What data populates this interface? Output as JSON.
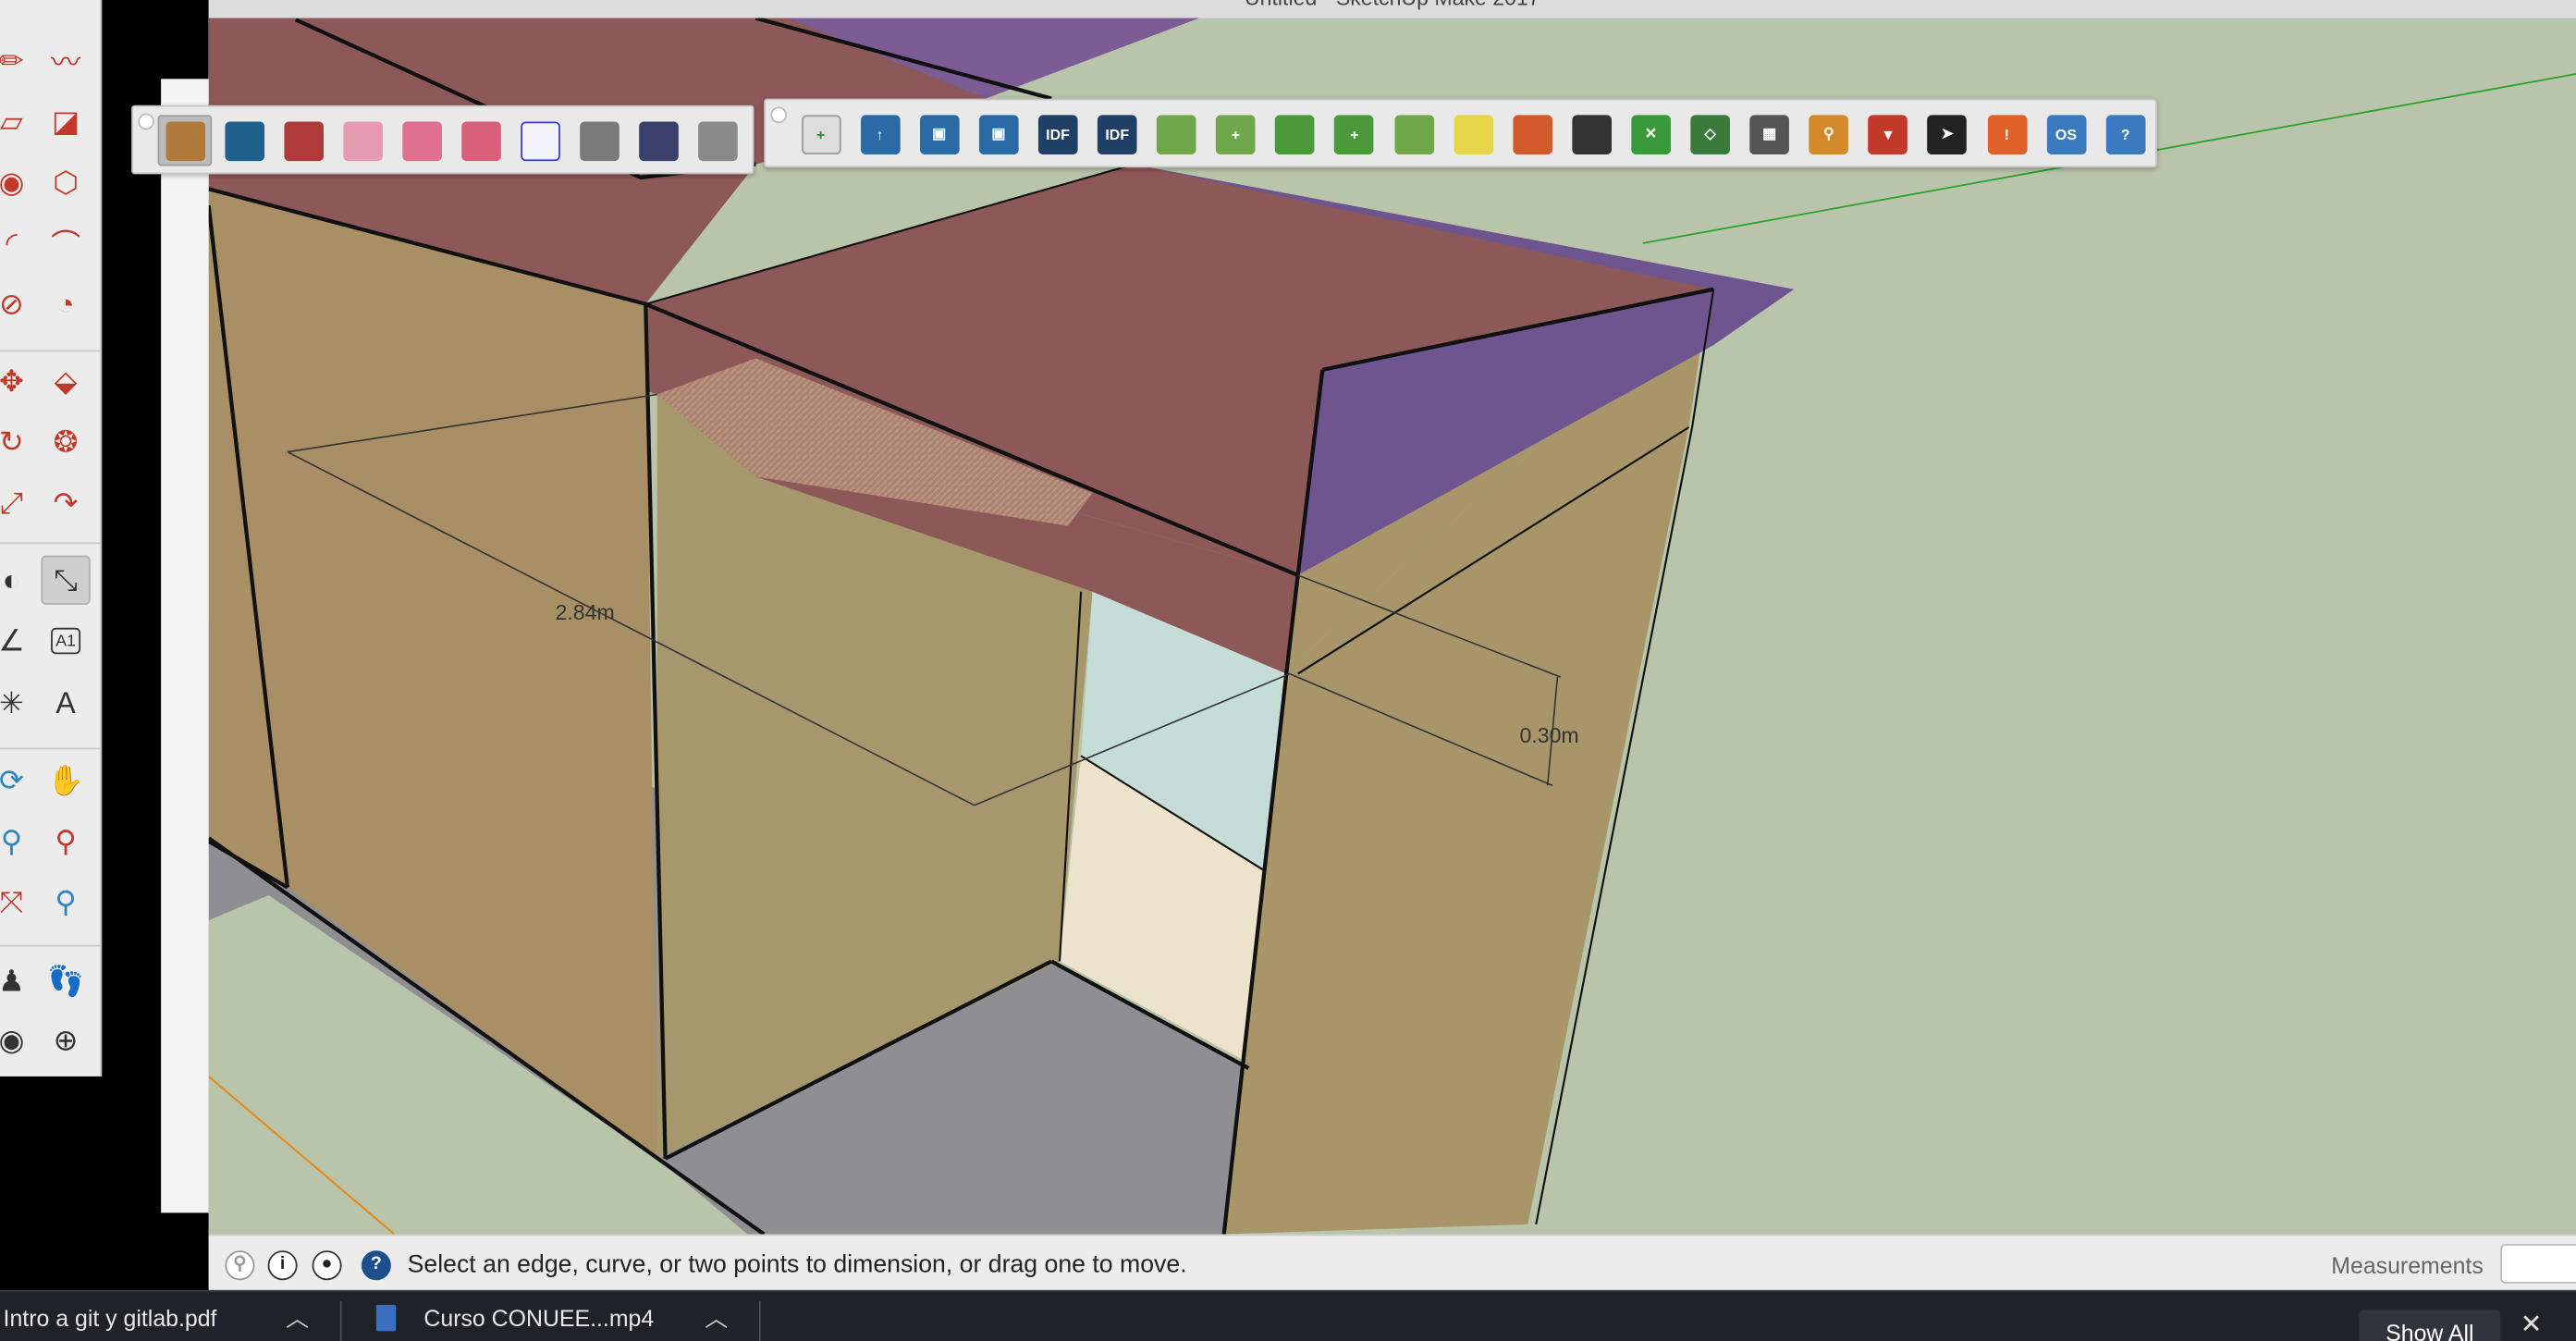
{
  "window": {
    "title": "Untitled - SketchUp Make 2017"
  },
  "left_palette": {
    "tools": [
      {
        "name": "line-tool-icon",
        "glyph": "✏",
        "color": "#c0392b"
      },
      {
        "name": "freehand-tool-icon",
        "glyph": "〰",
        "color": "#c0392b"
      },
      {
        "name": "rectangle-tool-icon",
        "glyph": "▱",
        "color": "#c0392b"
      },
      {
        "name": "rotated-rectangle-tool-icon",
        "glyph": "◪",
        "color": "#c0392b"
      },
      {
        "name": "circle-tool-icon",
        "glyph": "◉",
        "color": "#c0392b"
      },
      {
        "name": "polygon-tool-icon",
        "glyph": "⬡",
        "color": "#c0392b"
      },
      {
        "name": "arc-tool-icon",
        "glyph": "◜",
        "color": "#c0392b"
      },
      {
        "name": "two-point-arc-tool-icon",
        "glyph": "⌒",
        "color": "#c0392b"
      },
      {
        "name": "three-point-arc-tool-icon",
        "glyph": "⊘",
        "color": "#c0392b"
      },
      {
        "name": "pie-tool-icon",
        "glyph": "◔",
        "color": "#c0392b"
      },
      {
        "name": "move-tool-icon",
        "glyph": "✥",
        "color": "#c0392b"
      },
      {
        "name": "push-pull-tool-icon",
        "glyph": "⬙",
        "color": "#c0392b"
      },
      {
        "name": "rotate-tool-icon",
        "glyph": "↻",
        "color": "#c0392b"
      },
      {
        "name": "follow-me-tool-icon",
        "glyph": "❂",
        "color": "#c0392b"
      },
      {
        "name": "scale-tool-icon",
        "glyph": "⤢",
        "color": "#c0392b"
      },
      {
        "name": "offset-tool-icon",
        "glyph": "↷",
        "color": "#c0392b"
      },
      {
        "name": "tape-measure-tool-icon",
        "glyph": "◐",
        "color": "#333333"
      },
      {
        "name": "dimension-tool-icon",
        "glyph": "⤡",
        "color": "#333333"
      },
      {
        "name": "protractor-tool-icon",
        "glyph": "∠",
        "color": "#333333"
      },
      {
        "name": "text-tool-icon",
        "glyph": "A1",
        "color": "#333333"
      },
      {
        "name": "axes-tool-icon",
        "glyph": "✳",
        "color": "#333333"
      },
      {
        "name": "3d-text-tool-icon",
        "glyph": "A",
        "color": "#333333"
      },
      {
        "name": "orbit-tool-icon",
        "glyph": "⟳",
        "color": "#2e86c1"
      },
      {
        "name": "pan-tool-icon",
        "glyph": "✋",
        "color": "#d4a017"
      },
      {
        "name": "zoom-tool-icon",
        "glyph": "⚲",
        "color": "#2e86c1"
      },
      {
        "name": "zoom-window-tool-icon",
        "glyph": "⚲",
        "color": "#c0392b"
      },
      {
        "name": "zoom-extents-tool-icon",
        "glyph": "⤧",
        "color": "#c0392b"
      },
      {
        "name": "previous-view-tool-icon",
        "glyph": "⚲",
        "color": "#2e86c1"
      },
      {
        "name": "position-camera-tool-icon",
        "glyph": "♟",
        "color": "#333333"
      },
      {
        "name": "walk-tool-icon",
        "glyph": "👣",
        "color": "#333333"
      },
      {
        "name": "look-around-tool-icon",
        "glyph": "◉",
        "color": "#333333"
      },
      {
        "name": "section-plane-tool-icon",
        "glyph": "⊕",
        "color": "#333333"
      }
    ]
  },
  "toolbar_openstudio_objects": {
    "buttons": [
      {
        "name": "new-space-icon",
        "color": "#b07a3c",
        "label": ""
      },
      {
        "name": "new-thermal-zone-icon",
        "color": "#1f5f8b",
        "label": ""
      },
      {
        "name": "new-surface-icon",
        "color": "#b03a3a",
        "label": ""
      },
      {
        "name": "new-subsurface-icon",
        "color": "#e79bb0",
        "label": ""
      },
      {
        "name": "new-shading-surface-icon",
        "color": "#e0708f",
        "label": ""
      },
      {
        "name": "new-interior-partition-icon",
        "color": "#d9607a",
        "label": ""
      },
      {
        "name": "wireframe-space-icon",
        "color": "#ffffff",
        "label": ""
      },
      {
        "name": "new-illuminance-map-icon",
        "color": "#7a7a7a",
        "label": ""
      },
      {
        "name": "new-daylighting-control-icon",
        "color": "#3b3f6b",
        "label": ""
      },
      {
        "name": "schedule-calendar-icon",
        "color": "#8a8a8a",
        "label": ""
      }
    ]
  },
  "toolbar_openstudio_main": {
    "buttons": [
      {
        "name": "new-file-icon",
        "color": "#dddddd",
        "label": "+"
      },
      {
        "name": "open-file-icon",
        "color": "#2a6aa6",
        "label": "↑"
      },
      {
        "name": "save-file-icon",
        "color": "#2a6aa6",
        "label": "▣"
      },
      {
        "name": "save-as-icon",
        "color": "#2a6aa6",
        "label": "▣"
      },
      {
        "name": "import-idf-icon",
        "color": "#1f3f66",
        "label": "IDF"
      },
      {
        "name": "export-idf-icon",
        "color": "#1f3f66",
        "label": "IDF"
      },
      {
        "name": "surface-matching-icon",
        "color": "#6ea84a",
        "label": ""
      },
      {
        "name": "add-space-type-icon",
        "color": "#6ea84a",
        "label": "+"
      },
      {
        "name": "set-attributes-icon",
        "color": "#4a9a3a",
        "label": ""
      },
      {
        "name": "add-construction-icon",
        "color": "#4a9a3a",
        "label": "+"
      },
      {
        "name": "render-by-thermal-zone-icon",
        "color": "#6ea84a",
        "label": ""
      },
      {
        "name": "add-light-icon",
        "color": "#e7d64a",
        "label": ""
      },
      {
        "name": "render-by-boundary-icon",
        "color": "#d25a2a",
        "label": ""
      },
      {
        "name": "split-surfaces-icon",
        "color": "#333333",
        "label": ""
      },
      {
        "name": "surface-intersect-icon",
        "color": "#3a9a3a",
        "label": "✕"
      },
      {
        "name": "show-floor-plane-icon",
        "color": "#3a7a3a",
        "label": "◇"
      },
      {
        "name": "show-all-icon",
        "color": "#555555",
        "label": "▦"
      },
      {
        "name": "inspector-search-icon",
        "color": "#d28a2a",
        "label": "⚲"
      },
      {
        "name": "filter-icon",
        "color": "#c23a2a",
        "label": "▼"
      },
      {
        "name": "info-tool-icon",
        "color": "#222222",
        "label": "➤"
      },
      {
        "name": "warning-icon",
        "color": "#e0602a",
        "label": "!"
      },
      {
        "name": "openstudio-app-icon",
        "color": "#3a7abf",
        "label": "OS"
      },
      {
        "name": "help-icon",
        "color": "#3a7abf",
        "label": "?"
      }
    ]
  },
  "viewport": {
    "dimension_width": "2.84m",
    "dimension_height": "0.30m"
  },
  "statusbar": {
    "hint": "Select an edge, curve, or two points to dimension, or drag one to move.",
    "measurements_label": "Measurements",
    "measurements_value": ""
  },
  "taskbar": {
    "item1": "Intro a git y gitlab.pdf",
    "item2": "Curso CONUEE...mp4",
    "show_all": "Show All",
    "close": "✕"
  }
}
